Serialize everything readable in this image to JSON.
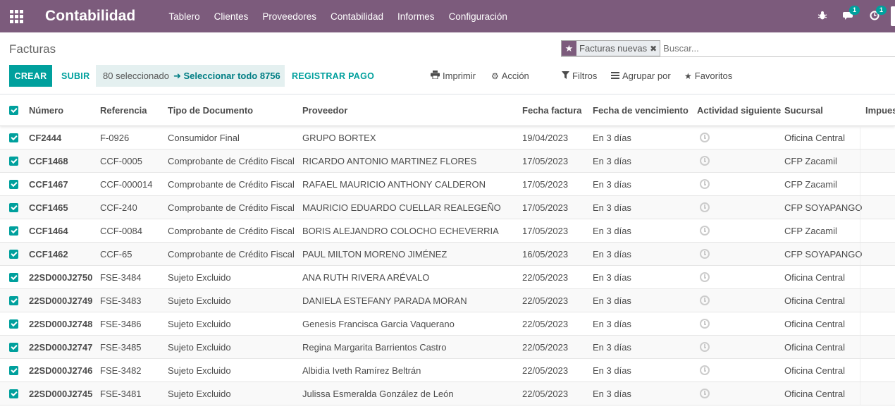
{
  "app": {
    "brand": "Contabilidad",
    "menu": [
      "Tablero",
      "Clientes",
      "Proveedores",
      "Contabilidad",
      "Informes",
      "Configuración"
    ],
    "messages_badge": "1",
    "activities_badge": "1"
  },
  "control": {
    "title": "Facturas",
    "facet_label": "Facturas nuevas",
    "search_placeholder": "Buscar...",
    "create_label": "CREAR",
    "upload_label": "SUBIR",
    "selected_text": "80 seleccionado",
    "select_all_label": "Seleccionar todo 8756",
    "register_payment_label": "REGISTRAR PAGO",
    "print_label": "Imprimir",
    "action_label": "Acción",
    "filters_label": "Filtros",
    "group_by_label": "Agrupar por",
    "favorites_label": "Favoritos"
  },
  "table": {
    "columns": [
      "Número",
      "Referencia",
      "Tipo de Documento",
      "Proveedor",
      "Fecha factura",
      "Fecha de vencimiento",
      "Actividad siguiente",
      "Sucursal",
      "Impues"
    ],
    "rows": [
      {
        "numero": "CF2444",
        "referencia": "F-0926",
        "tipo": "Consumidor Final",
        "proveedor": "GRUPO BORTEX",
        "fecha": "19/04/2023",
        "vencimiento": "En 3 días",
        "sucursal": "Oficina Central"
      },
      {
        "numero": "CCF1468",
        "referencia": "CCF-0005",
        "tipo": "Comprobante de Crédito Fiscal",
        "proveedor": "RICARDO ANTONIO MARTINEZ FLORES",
        "fecha": "17/05/2023",
        "vencimiento": "En 3 días",
        "sucursal": "CFP Zacamil"
      },
      {
        "numero": "CCF1467",
        "referencia": "CCF-000014",
        "tipo": "Comprobante de Crédito Fiscal",
        "proveedor": "RAFAEL MAURICIO ANTHONY CALDERON",
        "fecha": "17/05/2023",
        "vencimiento": "En 3 días",
        "sucursal": "CFP Zacamil"
      },
      {
        "numero": "CCF1465",
        "referencia": "CCF-240",
        "tipo": "Comprobante de Crédito Fiscal",
        "proveedor": "MAURICIO EDUARDO CUELLAR REALEGEÑO",
        "fecha": "17/05/2023",
        "vencimiento": "En 3 días",
        "sucursal": "CFP SOYAPANGO"
      },
      {
        "numero": "CCF1464",
        "referencia": "CCF-0084",
        "tipo": "Comprobante de Crédito Fiscal",
        "proveedor": "BORIS ALEJANDRO COLOCHO ECHEVERRIA",
        "fecha": "17/05/2023",
        "vencimiento": "En 3 días",
        "sucursal": "CFP Zacamil"
      },
      {
        "numero": "CCF1462",
        "referencia": "CCF-65",
        "tipo": "Comprobante de Crédito Fiscal",
        "proveedor": "PAUL MILTON MORENO JIMÉNEZ",
        "fecha": "16/05/2023",
        "vencimiento": "En 3 días",
        "sucursal": "CFP SOYAPANGO"
      },
      {
        "numero": "22SD000J2750",
        "referencia": "FSE-3484",
        "tipo": "Sujeto Excluido",
        "proveedor": "ANA RUTH RIVERA ARÉVALO",
        "fecha": "22/05/2023",
        "vencimiento": "En 3 días",
        "sucursal": "Oficina Central"
      },
      {
        "numero": "22SD000J2749",
        "referencia": "FSE-3483",
        "tipo": "Sujeto Excluido",
        "proveedor": "DANIELA ESTEFANY PARADA MORAN",
        "fecha": "22/05/2023",
        "vencimiento": "En 3 días",
        "sucursal": "Oficina Central"
      },
      {
        "numero": "22SD000J2748",
        "referencia": "FSE-3486",
        "tipo": "Sujeto Excluido",
        "proveedor": "Genesis Francisca Garcia Vaquerano",
        "fecha": "22/05/2023",
        "vencimiento": "En 3 días",
        "sucursal": "Oficina Central"
      },
      {
        "numero": "22SD000J2747",
        "referencia": "FSE-3485",
        "tipo": "Sujeto Excluido",
        "proveedor": "Regina Margarita Barrientos Castro",
        "fecha": "22/05/2023",
        "vencimiento": "En 3 días",
        "sucursal": "Oficina Central"
      },
      {
        "numero": "22SD000J2746",
        "referencia": "FSE-3482",
        "tipo": "Sujeto Excluido",
        "proveedor": "Albidia Iveth Ramírez Beltrán",
        "fecha": "22/05/2023",
        "vencimiento": "En 3 días",
        "sucursal": "Oficina Central"
      },
      {
        "numero": "22SD000J2745",
        "referencia": "FSE-3481",
        "tipo": "Sujeto Excluido",
        "proveedor": "Julissa Esmeralda González de León",
        "fecha": "22/05/2023",
        "vencimiento": "En 3 días",
        "sucursal": "Oficina Central"
      }
    ]
  },
  "colors": {
    "navbar": "#7c5b7c",
    "accent": "#00a09d"
  }
}
